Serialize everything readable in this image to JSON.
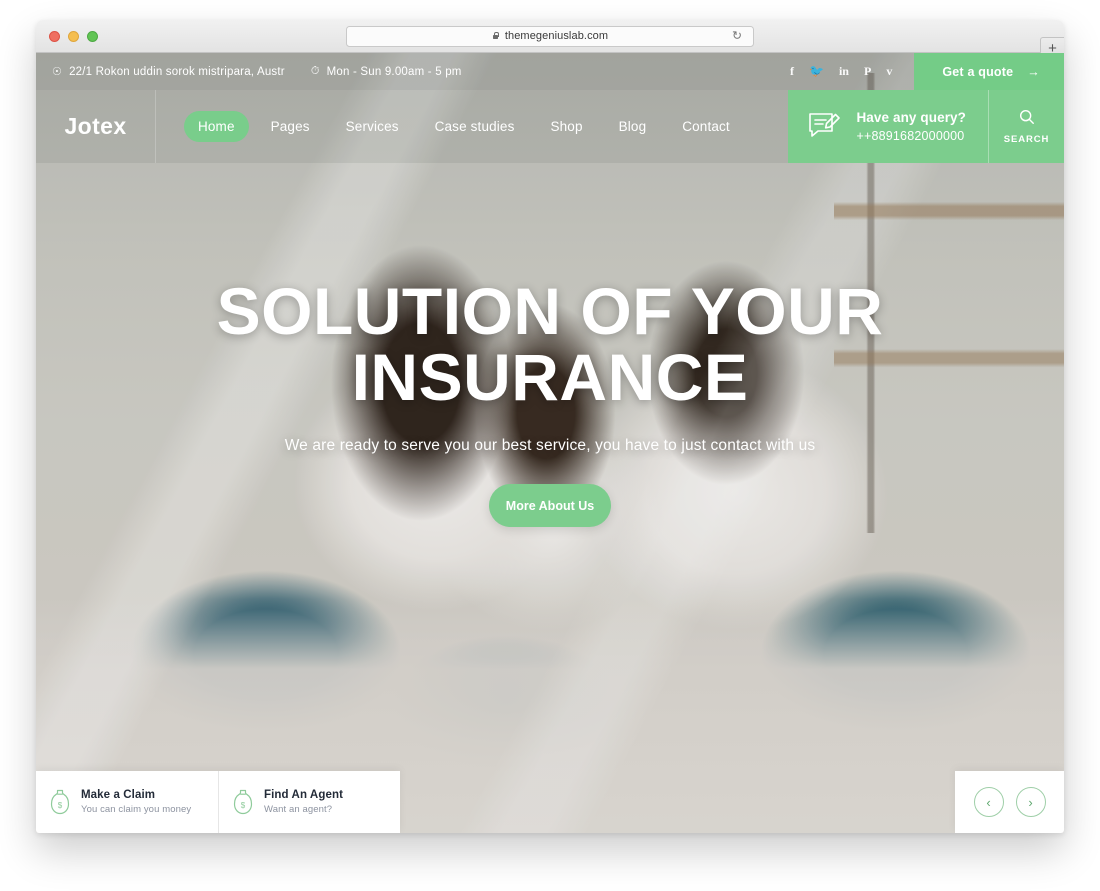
{
  "browser": {
    "url": "themegeniuslab.com",
    "lock_icon": "lock-icon",
    "reload_icon": "reload-icon",
    "newtab_label": "+",
    "traffic_lights": [
      "close-red",
      "minimize-yellow",
      "maximize-green"
    ]
  },
  "topbar": {
    "address": "22/1 Rokon uddin sorok mistripara, Austr",
    "address_icon": "location-pin-icon",
    "hours": "Mon - Sun 9.00am - 5 pm",
    "hours_icon": "clock-icon",
    "socials": [
      {
        "name": "facebook-icon",
        "glyph": "f"
      },
      {
        "name": "twitter-icon",
        "glyph": "🐦"
      },
      {
        "name": "linkedin-icon",
        "glyph": "in"
      },
      {
        "name": "pinterest-icon",
        "glyph": "P"
      },
      {
        "name": "vimeo-icon",
        "glyph": "v"
      }
    ],
    "quote_label": "Get a quote",
    "quote_arrow": "→"
  },
  "nav": {
    "brand": "Jotex",
    "links": [
      {
        "label": "Home",
        "active": true
      },
      {
        "label": "Pages",
        "active": false
      },
      {
        "label": "Services",
        "active": false
      },
      {
        "label": "Case studies",
        "active": false
      },
      {
        "label": "Shop",
        "active": false
      },
      {
        "label": "Blog",
        "active": false
      },
      {
        "label": "Contact",
        "active": false
      }
    ],
    "query": {
      "icon": "message-edit-icon",
      "title": "Have any query?",
      "phone": "++8891682000000"
    },
    "search": {
      "icon": "search-icon",
      "label": "SEARCH"
    }
  },
  "hero": {
    "title_line1": "SOLUTION OF YOUR",
    "title_line2": "INSURANCE",
    "subtitle": "We are ready to serve you our best service, you have to just contact with us",
    "cta_label": "More About Us"
  },
  "cards": [
    {
      "icon": "money-bag-icon",
      "title": "Make a Claim",
      "subtitle": "You can claim you money"
    },
    {
      "icon": "money-bag-icon",
      "title": "Find An Agent",
      "subtitle": "Want an agent?"
    }
  ],
  "slider": {
    "prev_icon": "chevron-left-icon",
    "prev_glyph": "‹",
    "next_icon": "chevron-right-icon",
    "next_glyph": "›"
  },
  "colors": {
    "accent_green": "#7ccd8d",
    "quote_green": "#74cc87",
    "card_title": "#232b38",
    "card_sub": "#8d93a0"
  }
}
